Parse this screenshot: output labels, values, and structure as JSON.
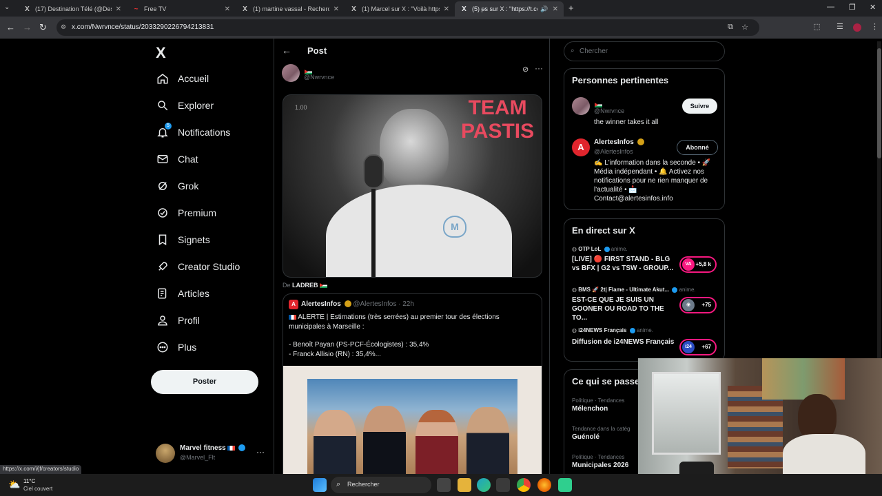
{
  "browser": {
    "tabs": [
      {
        "title": "(17) Destination Télé (@Destina",
        "favicon": "X",
        "active": false
      },
      {
        "title": "Free TV",
        "favicon": "~",
        "active": false
      },
      {
        "title": "(1) martine vassal - Recherche /",
        "favicon": "X",
        "active": false
      },
      {
        "title": "(1) Marcel sur X : \"Voilà https://",
        "favicon": "X",
        "active": false
      },
      {
        "title": "(5) ᵽs sur X : \"https://t.co/A",
        "favicon": "X",
        "active": true
      }
    ],
    "new_tab": "+",
    "url": "x.com/Nwrvnce/status/2033290226794213831",
    "status_url": "https://x.com/i/jf/creators/studio"
  },
  "sidebar": {
    "logo": "X",
    "items": [
      {
        "label": "Accueil",
        "icon": "home-icon"
      },
      {
        "label": "Explorer",
        "icon": "search-icon"
      },
      {
        "label": "Notifications",
        "icon": "bell-icon",
        "badge": "5"
      },
      {
        "label": "Chat",
        "icon": "mail-icon"
      },
      {
        "label": "Grok",
        "icon": "grok-icon"
      },
      {
        "label": "Premium",
        "icon": "premium-icon"
      },
      {
        "label": "Signets",
        "icon": "bookmark-icon"
      },
      {
        "label": "Creator Studio",
        "icon": "rocket-icon"
      },
      {
        "label": "Articles",
        "icon": "article-icon"
      },
      {
        "label": "Profil",
        "icon": "person-icon"
      },
      {
        "label": "Plus",
        "icon": "more-circle-icon"
      }
    ],
    "post_button": "Poster",
    "account": {
      "name": "Marvel fitness",
      "handle": "@Marvel_Flt",
      "more": "···"
    }
  },
  "post": {
    "header": "Post",
    "author_handle": "@Nwrvnce",
    "image_badge": "1.00",
    "image_text": [
      "TEAM",
      "PASTIS"
    ],
    "via_prefix": "De",
    "via_name": "LADREB",
    "quote": {
      "name": "AlertesInfos",
      "handle": "@AlertesInfos",
      "time": "· 22h",
      "lines": [
        "ALERTE | Estimations (très serrées) au premier tour des élections municipales à Marseille :",
        "",
        "- Benoît Payan (PS-PCF-Écologistes) : 35,4%",
        "- Franck Allisio (RN) : 35,4%..."
      ]
    }
  },
  "right": {
    "search_placeholder": "Chercher",
    "relevant": {
      "title": "Personnes pertinentes",
      "people": [
        {
          "handle": "@Nwrvnce",
          "bio": "the winner takes it all",
          "button": "Suivre"
        },
        {
          "name": "AlertesInfos",
          "handle": "@AlertesInfos",
          "bio": "✍️ L'information dans la seconde • 🚀 Média indépendant • 🔔 Activez nos notifications pour ne rien manquer de l'actualité • 📩 Contact@alertesinfos.info",
          "button": "Abonné"
        }
      ]
    },
    "live": {
      "title": "En direct sur X",
      "items": [
        {
          "host": "OTP LoL",
          "status": "anime.",
          "title": "[LIVE] 🔴 FIRST STAND - BLG vs BFX | G2 vs TSW - GROUP...",
          "count": "+5,8 k",
          "av": "VA"
        },
        {
          "host": "BMS 🚀 2t| Flame - Ultimate Akut...",
          "status": "anime.",
          "title": "EST-CE QUE JE SUIS UN GOONER OU ROAD TO THE TO...",
          "count": "+75",
          "av": "◉"
        },
        {
          "host": "i24NEWS Français",
          "status": "anime.",
          "title": "Diffusion de i24NEWS Français",
          "count": "+67",
          "av": "i24"
        }
      ]
    },
    "happening": {
      "title": "Ce qui se passe",
      "items": [
        {
          "category": "Politique · Tendances",
          "topic": "Mélenchon"
        },
        {
          "category": "Tendance dans la catég",
          "topic": "Guénolé"
        },
        {
          "category": "Politique · Tendances",
          "topic": "Municipales 2026"
        }
      ]
    }
  },
  "taskbar": {
    "temp": "11°C",
    "weather": "Ciel couvert",
    "search": "Rechercher"
  }
}
